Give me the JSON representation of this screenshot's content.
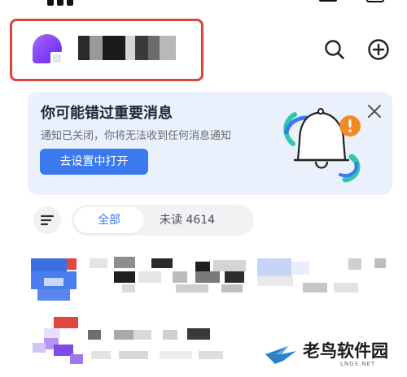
{
  "banner": {
    "title": "你可能错过重要消息",
    "subtitle": "通知已关闭，你将无法收到任何消息通知",
    "button_label": "去设置中打开"
  },
  "filter": {
    "tab_all": "全部",
    "tab_unread": "未读 4614"
  },
  "icons": {
    "search": "search-icon",
    "add": "plus-circle-icon",
    "close": "close-icon",
    "filter": "filter-lines-icon",
    "bell": "bell-alert-illustration"
  },
  "colors": {
    "accent": "#3b79ee",
    "highlight_border": "#d9473b",
    "banner_bg": "#eaf1fd",
    "avatar": "#7f3cf5",
    "alert_badge": "#f08a24"
  },
  "watermark": {
    "text": "老鸟软件园",
    "url": "LNGS.NET"
  }
}
